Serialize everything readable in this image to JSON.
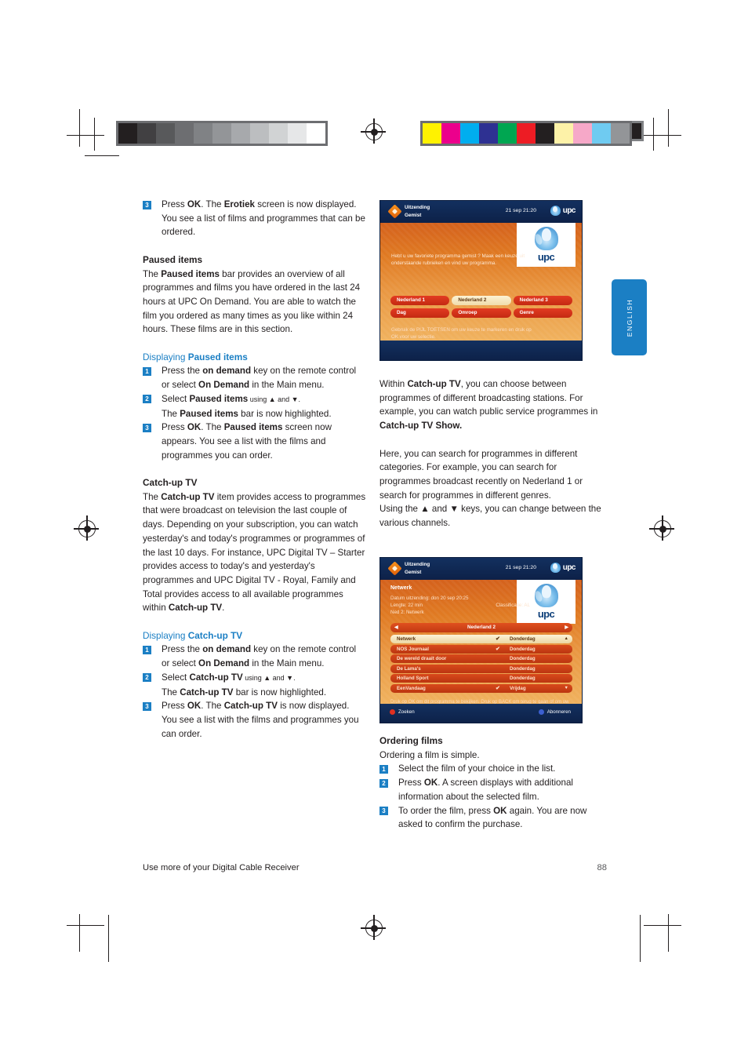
{
  "page": {
    "footer_title": "Use more of your Digital Cable Receiver",
    "page_number": "88",
    "language_tab": "ENGLISH"
  },
  "calibration": {
    "gray_swatches": [
      "#231f20",
      "#414042",
      "#58595b",
      "#6d6e71",
      "#808285",
      "#939598",
      "#a7a9ac",
      "#bcbec0",
      "#d1d3d4",
      "#e6e7e8",
      "#ffffff"
    ],
    "color_swatches": [
      "#fff200",
      "#ec008c",
      "#00aeef",
      "#2e3192",
      "#00a651",
      "#ed1c24",
      "#231f20",
      "#fdf2a8",
      "#f6a8c8",
      "#6fcbf1",
      "#939598"
    ]
  },
  "left_column": {
    "step3_top": {
      "num": "3",
      "parts": [
        "Press ",
        "OK",
        ". The ",
        "Erotiek",
        " screen is now displayed. You see a list of films and programmes that can be ordered."
      ]
    },
    "paused_items": {
      "heading": "Paused items",
      "body_parts": [
        "The ",
        "Paused items",
        " bar provides an overview of all programmes and films you have ordered in the last 24 hours at UPC On Demand. You are able to watch the film you ordered as many times as you like within 24 hours. These films are in this section."
      ]
    },
    "displaying_paused": {
      "subhead_prefix": "Displaying ",
      "subhead_bold": "Paused items",
      "steps": [
        {
          "num": "1",
          "text_parts": [
            "Press the ",
            "on demand",
            " key on the remote control or select ",
            "On Demand",
            " in the Main menu."
          ]
        },
        {
          "num": "2",
          "text_parts": [
            "Select ",
            "Paused items",
            " using ▲ and ▼.",
            "The ",
            "Paused items",
            " bar is now highlighted."
          ]
        },
        {
          "num": "3",
          "text_parts": [
            "Press ",
            "OK",
            ". The ",
            "Paused items",
            " screen now appears. You see a list with the films and programmes you can order."
          ]
        }
      ]
    },
    "catchup_tv": {
      "heading": "Catch-up TV",
      "body_parts": [
        "The ",
        "Catch-up TV",
        " item provides access to programmes that were broadcast on television the last couple of days. Depending on your subscription, you can watch yesterday's and today's programmes or programmes of the last 10 days. For instance, UPC Digital TV – Starter provides access to today's and yesterday's programmes and UPC Digital TV - Royal, Family and Total provides access to all available programmes within ",
        "Catch-up TV",
        "."
      ]
    },
    "displaying_catchup": {
      "subhead_prefix": "Displaying ",
      "subhead_bold": "Catch-up TV",
      "steps": [
        {
          "num": "1",
          "text_parts": [
            "Press the ",
            "on demand",
            " key on the remote control or select ",
            "On Demand",
            " in the Main menu."
          ]
        },
        {
          "num": "2",
          "text_parts": [
            "Select ",
            "Catch-up TV",
            " using ▲ and ▼.",
            "The ",
            "Catch-up TV",
            " bar is now highlighted."
          ]
        },
        {
          "num": "3",
          "text_parts": [
            "Press ",
            "OK",
            ". The ",
            "Catch-up TV",
            " is now displayed. You see a list with the films and programmes you can order."
          ]
        }
      ]
    }
  },
  "right_column": {
    "para1_parts": [
      "Within ",
      "Catch-up TV",
      ", you can choose between programmes of different broadcasting stations. For example, you can watch public service programmes in ",
      "Catch-up TV Show."
    ],
    "para2": "Here, you can search for programmes in different categories. For example, you can search for programmes broadcast recently on Nederland 1 or search for programmes in different genres.",
    "para3": "Using the ▲ and ▼ keys, you can change between the various channels.",
    "ordering_films": {
      "heading": "Ordering films",
      "intro": "Ordering a film is simple.",
      "steps": [
        {
          "num": "1",
          "text_parts": [
            "Select the film of your choice in the list."
          ]
        },
        {
          "num": "2",
          "text_parts": [
            "Press ",
            "OK",
            ". A screen displays with additional information about the selected film."
          ]
        },
        {
          "num": "3",
          "text_parts": [
            "To order the film, press ",
            "OK",
            " again. You are now asked to confirm the purchase."
          ]
        }
      ]
    }
  },
  "tv_screen_1": {
    "brand_line1": "Uitzending",
    "brand_line2": "Gemist",
    "time": "21 sep 21:20",
    "logo_word": "upc",
    "intro": "Hebt u uw favoriete programma gemist ? Maak een keuze uit onderstaande rubrieken en vind uw programma.",
    "buttons": [
      {
        "label": "Nederland 1",
        "selected": false
      },
      {
        "label": "Nederland 2",
        "selected": true
      },
      {
        "label": "Nederland 3",
        "selected": false
      },
      {
        "label": "Dag",
        "selected": false
      },
      {
        "label": "Omroep",
        "selected": false
      },
      {
        "label": "Genre",
        "selected": false
      }
    ],
    "help": "Gebruik de PIJL TOETSEN om uw keuze te markeren en druk op OK voor uw selectie."
  },
  "tv_screen_2": {
    "brand_line1": "Uitzending",
    "brand_line2": "Gemist",
    "time": "21 sep 21:20",
    "logo_word": "upc",
    "info": {
      "title": "Netwerk",
      "line1": "Datum uitzending: don 20 sep 20:25",
      "line2_left": "Lengte: 22 min",
      "line2_right": "Classificatie: AL",
      "line3": "Ned 2: Netwerk"
    },
    "channel_bar": "Nederland 2",
    "rows": [
      {
        "name": "Netwerk",
        "day": "Donderdag",
        "selected": true,
        "check": true,
        "scroll": "▲"
      },
      {
        "name": "NOS Journaal",
        "day": "Donderdag",
        "selected": false,
        "check": true,
        "scroll": ""
      },
      {
        "name": "De wereld draait door",
        "day": "Donderdag",
        "selected": false,
        "check": false,
        "scroll": ""
      },
      {
        "name": "De Lama's",
        "day": "Donderdag",
        "selected": false,
        "check": false,
        "scroll": ""
      },
      {
        "name": "Holland Sport",
        "day": "Donderdag",
        "selected": false,
        "check": false,
        "scroll": ""
      },
      {
        "name": "EenVandaag",
        "day": "Vrijdag",
        "selected": false,
        "check": true,
        "scroll": "▼"
      }
    ],
    "hint": "Druk op OK om dit programma te bekijken. Druk op BACK om terug te gaan of om uw acties te annuleren.",
    "foot_left": "Zoeken",
    "foot_right": "Abonneren"
  }
}
